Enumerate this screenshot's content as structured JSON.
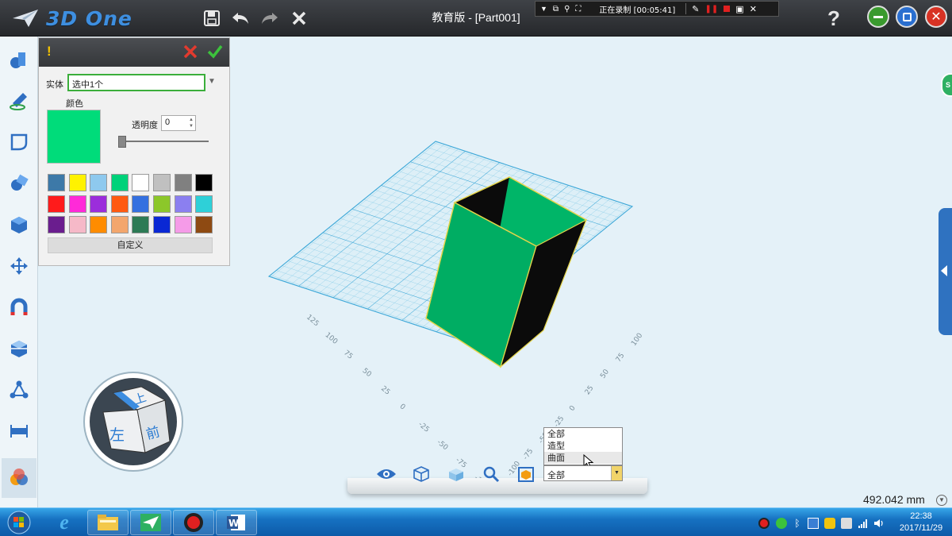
{
  "app": {
    "logo_text": "3D One",
    "document_title": "教育版 - [Part001]",
    "help": "?"
  },
  "recorder": {
    "status": "正在录制 [00:05:41]"
  },
  "color_panel": {
    "entity_label": "实体",
    "entity_value": "选中1个",
    "color_label": "颜色",
    "transparency_label": "透明度",
    "transparency_value": "0",
    "transparency_level": 0,
    "selected_color": "#00dc7a",
    "custom_button": "自定义",
    "swatches": [
      "#3d79a8",
      "#fff200",
      "#8ec9ee",
      "#00d27a",
      "#ffffff",
      "#c0c0c0",
      "#808080",
      "#000000",
      "#ff1b1b",
      "#ff2ad8",
      "#9b2ddb",
      "#ff5a10",
      "#3470e0",
      "#8cc72a",
      "#8b7ff0",
      "#2ed0d8",
      "#6a1d8e",
      "#f6b9c8",
      "#ff8c00",
      "#f3a66d",
      "#2d7a55",
      "#0a28d4",
      "#f59be8",
      "#8e4a12"
    ]
  },
  "viewport": {
    "grid_ticks_left": [
      "125",
      "100",
      "75",
      "50",
      "25",
      "0",
      "-25",
      "-50",
      "-75",
      "-100"
    ],
    "grid_ticks_right": [
      "100",
      "75",
      "50",
      "25",
      "0",
      "-25",
      "-50",
      "-75",
      "-100"
    ],
    "view_cube": {
      "top_label": "上",
      "left_label": "左",
      "front_label": "前"
    },
    "distance_readout": "492.042 mm"
  },
  "filter": {
    "selected": "全部",
    "options": [
      "全部",
      "造型",
      "曲面"
    ],
    "hovered_option": "曲面"
  },
  "side_badge": "S",
  "taskbar": {
    "time": "22:38",
    "date": "2017/11/29"
  }
}
